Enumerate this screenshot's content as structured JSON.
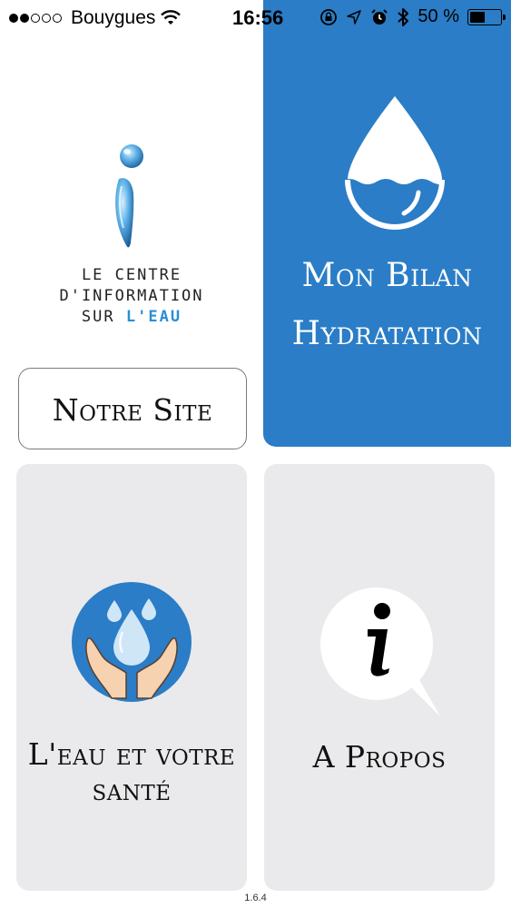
{
  "status_bar": {
    "carrier": "Bouygues",
    "time": "16:56",
    "battery": "50 %",
    "battery_level": 0.5
  },
  "logo": {
    "line1": "LE CENTRE",
    "line2": "D'INFORMATION",
    "line3_prefix": "SUR",
    "line3_highlight": "L'EAU"
  },
  "tiles": {
    "hydration": {
      "label_line1": "Mon Bilan",
      "label_line2": "Hydratation"
    },
    "site": {
      "label": "Notre Site"
    },
    "health": {
      "label": "L'eau et votre santé"
    },
    "about": {
      "label": "A Propos"
    }
  },
  "footer": {
    "version": "1.6.4"
  },
  "colors": {
    "accent_blue": "#2a7dc6",
    "tile_gray": "#eaeaec",
    "logo_blue": "#2a8fd6"
  }
}
